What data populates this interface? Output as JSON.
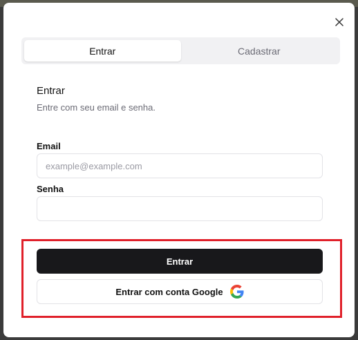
{
  "tabs": [
    {
      "label": "Entrar",
      "active": true
    },
    {
      "label": "Cadastrar",
      "active": false
    }
  ],
  "form": {
    "title": "Entrar",
    "subtitle": "Entre com seu email e senha.",
    "email_label": "Email",
    "email_placeholder": "example@example.com",
    "email_value": "",
    "password_label": "Senha",
    "password_value": ""
  },
  "buttons": {
    "submit_label": "Entrar",
    "google_label": "Entrar com conta Google"
  },
  "icons": {
    "close": "close-icon",
    "google": "google-logo-icon"
  },
  "colors": {
    "primary_button": "#18181b",
    "highlight_border": "#e0202a"
  }
}
